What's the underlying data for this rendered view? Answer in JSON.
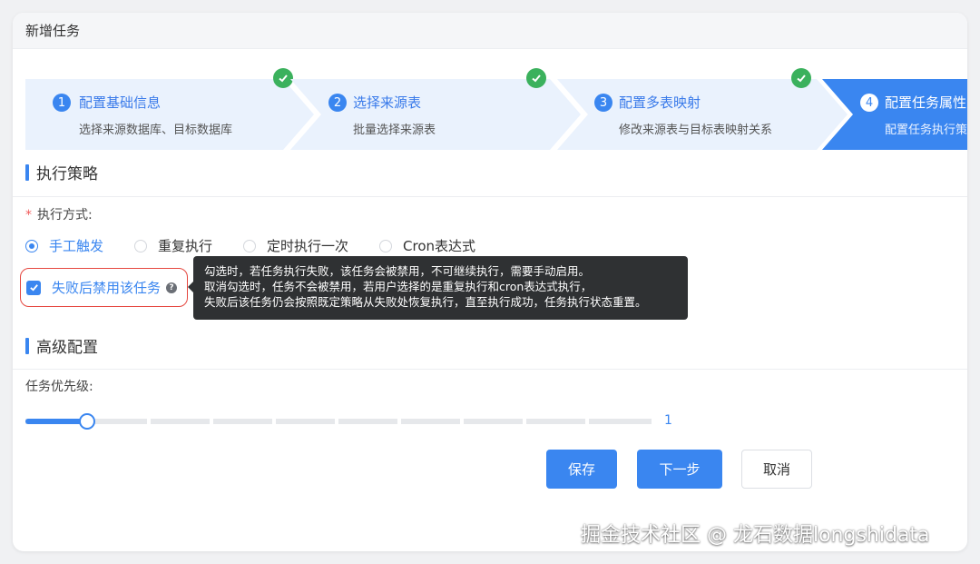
{
  "header": {
    "title": "新增任务"
  },
  "steps": [
    {
      "num": "1",
      "title": "配置基础信息",
      "desc": "选择来源数据库、目标数据库",
      "done": true
    },
    {
      "num": "2",
      "title": "选择来源表",
      "desc": "批量选择来源表",
      "done": true
    },
    {
      "num": "3",
      "title": "配置多表映射",
      "desc": "修改来源表与目标表映射关系",
      "done": true
    },
    {
      "num": "4",
      "title": "配置任务属性",
      "desc": "配置任务执行策",
      "done": false,
      "active": true
    }
  ],
  "section_strategy": {
    "title": "执行策略"
  },
  "exec_mode": {
    "required_mark": "*",
    "label": "执行方式:",
    "options": [
      "手工触发",
      "重复执行",
      "定时执行一次",
      "Cron表达式"
    ],
    "selected": "手工触发"
  },
  "disable_on_fail": {
    "label": "失败后禁用该任务",
    "checked": true,
    "help_icon": "question-icon"
  },
  "tooltip": {
    "lines": [
      "勾选时，若任务执行失败，该任务会被禁用，不可继续执行，需要手动启用。",
      "取消勾选时，任务不会被禁用，若用户选择的是重复执行和cron表达式执行，",
      "失败后该任务仍会按照既定策略从失败处恢复执行，直至执行成功，任务执行状态重置。"
    ]
  },
  "section_advanced": {
    "title": "高级配置"
  },
  "priority": {
    "label": "任务优先级:",
    "value": "1",
    "min": 1,
    "max": 10
  },
  "buttons": {
    "save": "保存",
    "next": "下一步",
    "cancel": "取消"
  },
  "watermark": "掘金技术社区 @ 龙石数据longshidata",
  "colors": {
    "accent": "#3a86f0",
    "success": "#3bb15d",
    "danger": "#e5473f",
    "step_bg": "#eaf2fd"
  }
}
